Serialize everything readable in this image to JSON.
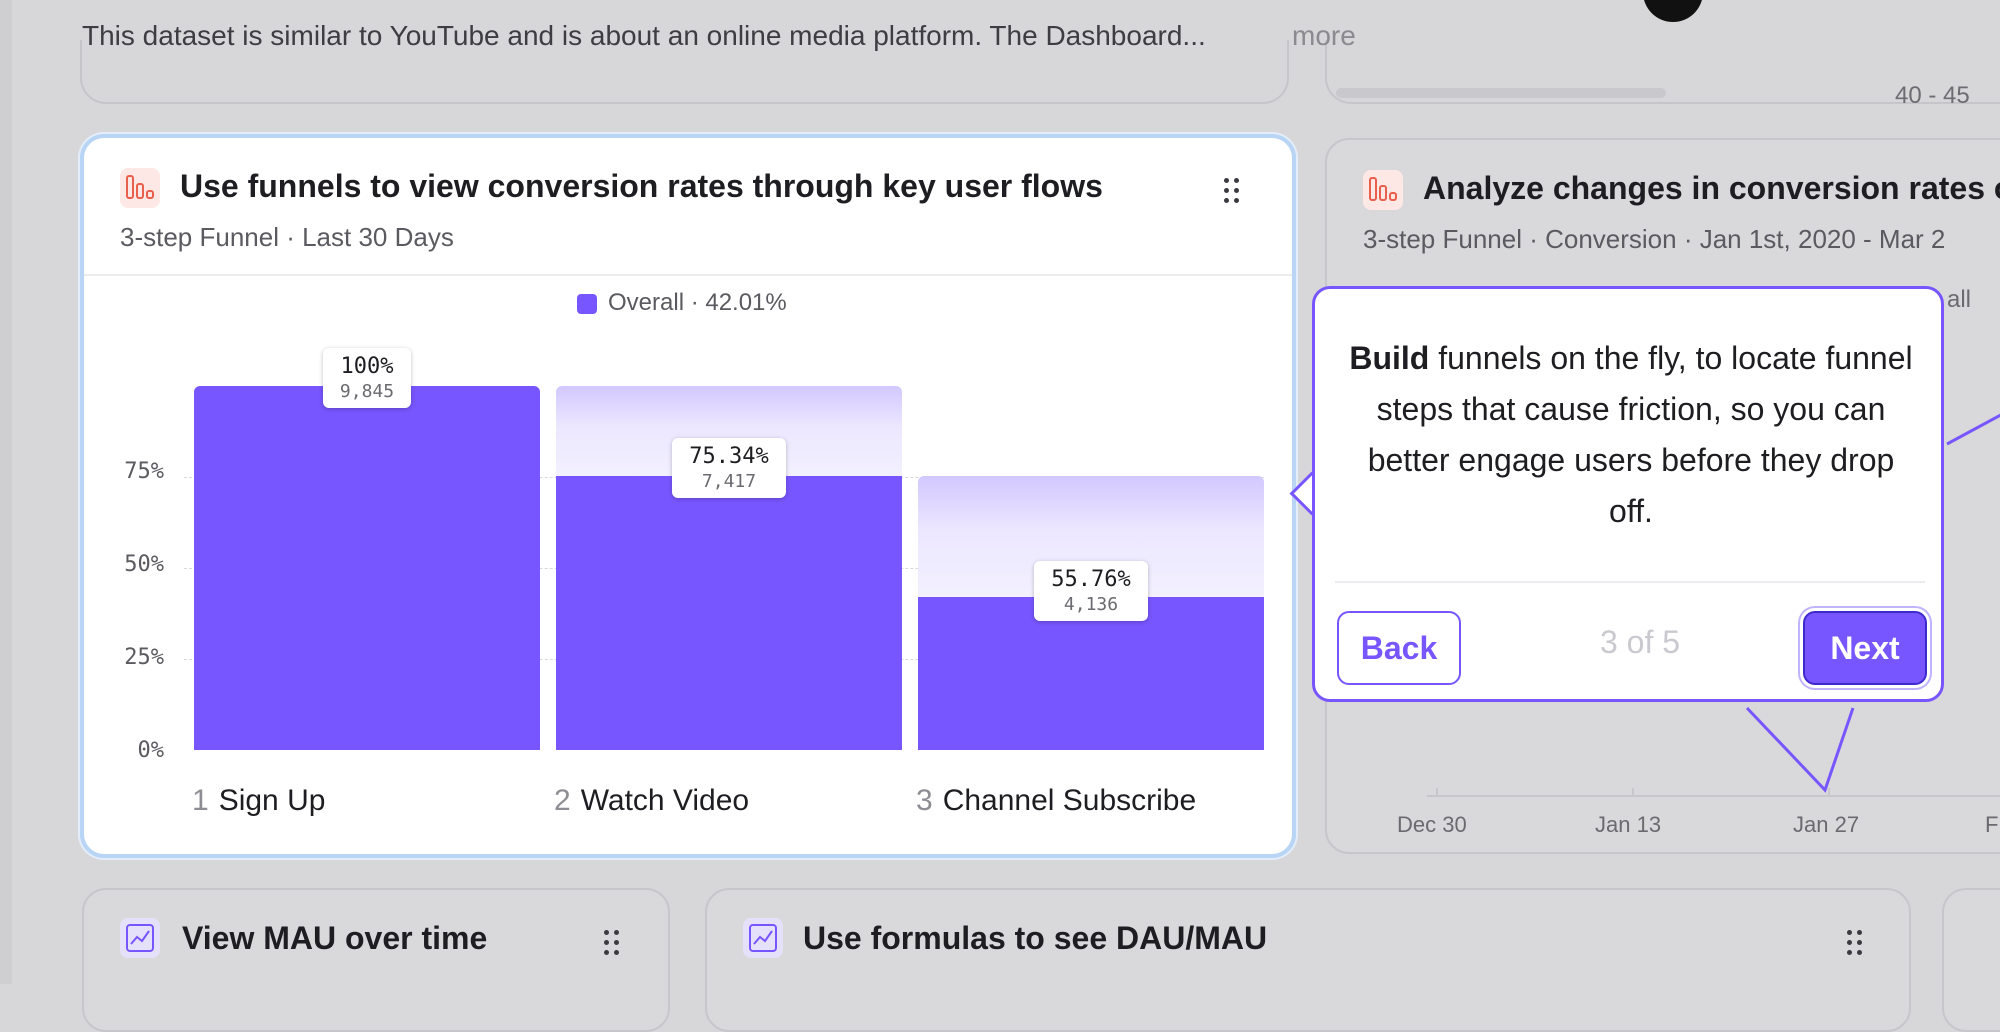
{
  "header": {
    "description": "This dataset is similar to YouTube and is about an online media platform. The Dashboard...",
    "more_link": "more",
    "age_label": "40 - 45"
  },
  "main_card": {
    "title": "Use funnels to view conversion rates through key user flows",
    "subtitle": "3-step Funnel · Last 30 Days",
    "icon": "funnel-icon",
    "legend": "Overall · 42.01%"
  },
  "chart_data": {
    "type": "bar",
    "categories": [
      "Sign Up",
      "Watch Video",
      "Channel Subscribe"
    ],
    "step_numbers": [
      "1",
      "2",
      "3"
    ],
    "values": [
      100,
      75.34,
      55.76
    ],
    "overall_conversion": [
      100,
      75.34,
      42.01
    ],
    "counts": [
      "9,845",
      "7,417",
      "4,136"
    ],
    "percent_labels": [
      "100%",
      "75.34%",
      "55.76%"
    ],
    "series": [
      {
        "name": "Overall · 42.01%",
        "values": [
          100,
          75.34,
          42.01
        ]
      }
    ],
    "yticks": [
      "0%",
      "25%",
      "50%",
      "75%"
    ],
    "ylim": [
      0,
      100
    ],
    "color": "#7856ff",
    "legend_position": "top-center",
    "grid": true
  },
  "right_card": {
    "title": "Analyze changes in conversion rates o",
    "subtitle": "3-step Funnel · Conversion · Jan 1st, 2020 - Mar 2",
    "legend_partial": "all",
    "x_labels": [
      "Dec 30",
      "Jan 13",
      "Jan 27",
      "F"
    ]
  },
  "tooltip": {
    "bold_word": "Build",
    "text": " funnels on the fly, to locate funnel steps that cause friction, so you can better engage users before they drop off.",
    "back_label": "Back",
    "next_label": "Next",
    "step_count": "3 of 5"
  },
  "bottom_cards": [
    {
      "title": "View MAU over time",
      "icon": "line-chart-icon"
    },
    {
      "title": "Use formulas to see DAU/MAU",
      "icon": "line-chart-icon"
    }
  ],
  "colors": {
    "accent": "#7856ff",
    "funnel_icon": "#e8604c",
    "focus_border": "#b8d5f5"
  }
}
